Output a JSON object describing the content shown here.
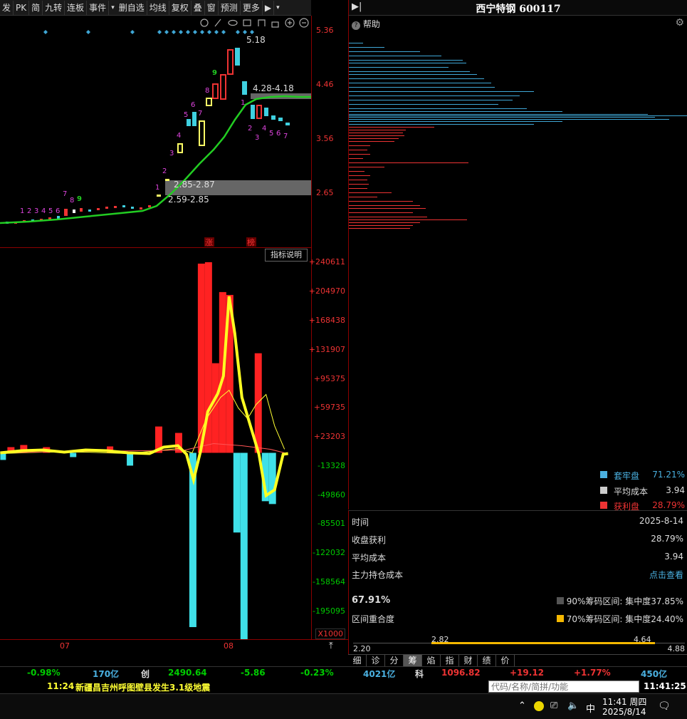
{
  "toolbar": {
    "items": [
      "发",
      "PK",
      "简",
      "九转",
      "连板",
      "事件",
      "▾",
      "删自选",
      "均线",
      "复权",
      "叠",
      "窗",
      "预测",
      "更多",
      "▶",
      "▾"
    ]
  },
  "kline": {
    "price_ticks": [
      "5.36",
      "4.46",
      "3.56",
      "2.65"
    ],
    "labels": {
      "high": "5.18",
      "upper_band": "4.28-4.18",
      "lower_band_top": "2.85-2.87",
      "lower_band_bottom": "2.59-2.85",
      "marker_zhang": "涨",
      "marker_bang": "榜"
    },
    "seq_labels": [
      "1",
      "2",
      "3",
      "4",
      "5",
      "6",
      "7",
      "8",
      "9"
    ]
  },
  "indicator": {
    "button": "指标说明",
    "ticks": [
      "+240611",
      "+204970",
      "+168438",
      "+131907",
      "+95375",
      "+59735",
      "+23203",
      "-13328",
      "-49860",
      "-85501",
      "-122032",
      "-158564",
      "-195095"
    ],
    "multiplier": "X1000"
  },
  "date_axis": {
    "labels": [
      "07",
      "08"
    ]
  },
  "right_panel": {
    "title": "西宁特钢 600117",
    "help": "帮助",
    "legend": [
      {
        "label": "套牢盘",
        "value": "71.21%",
        "color": "#4ab0e0"
      },
      {
        "label": "平均成本",
        "value": "3.94",
        "color": "#cccccc"
      },
      {
        "label": "获利盘",
        "value": "28.79%",
        "color": "#e33333"
      }
    ],
    "info": [
      {
        "label": "时间",
        "value": "2025-8-14"
      },
      {
        "label": "收盘获利",
        "value": "28.79%"
      },
      {
        "label": "平均成本",
        "value": "3.94"
      },
      {
        "label": "主力持仓成本",
        "value": "点击查看"
      }
    ],
    "overlap_pct": "67.91%",
    "overlap_label": "区间重合度",
    "range90": "90%筹码区间: 集中度37.85%",
    "range70": "70%筹码区间: 集中度24.40%",
    "range_bar": {
      "min": "2.20",
      "max": "4.88",
      "left": "2.82",
      "right": "4.64"
    },
    "tabs": [
      "细",
      "诊",
      "分",
      "筹",
      "焰",
      "指",
      "财",
      "绩",
      "价"
    ],
    "active_tab": "筹"
  },
  "ticker": {
    "items": [
      "-0.98%",
      "170亿",
      "创",
      "2490.64",
      "-5.86",
      "-0.23%",
      "4021亿",
      "科",
      "1096.82",
      "+19.12",
      "+1.77%",
      "450亿"
    ]
  },
  "news": {
    "time": "11:24",
    "text": "新疆昌吉州呼图壁县发生3.1级地震",
    "search_placeholder": "代码/名称/简拼/功能",
    "clock": "11:41:25"
  },
  "taskbar": {
    "ime": "中",
    "time": "11:41 周四",
    "date": "2025/8/14"
  }
}
